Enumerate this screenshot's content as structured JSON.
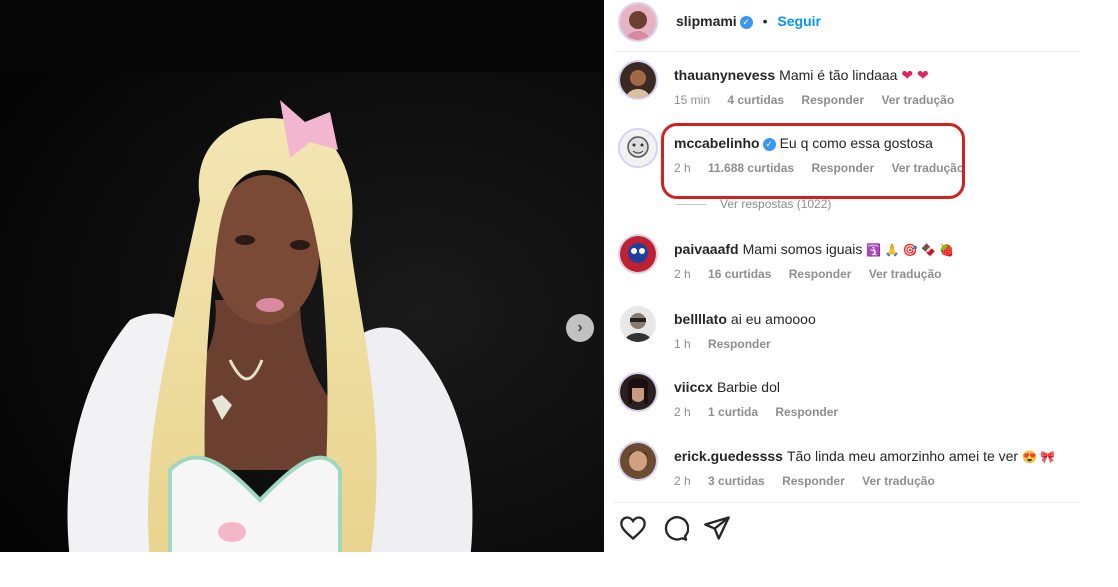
{
  "post": {
    "author": "slipmami",
    "verified_mark": "✓",
    "separator": "•",
    "follow_label": "Seguir"
  },
  "media": {
    "next_icon": "›"
  },
  "comments": [
    {
      "username": "thauanynevess",
      "text": "Mami é tão lindaaa",
      "emoji": "❤ ❤",
      "time": "15 min",
      "likes": "4 curtidas",
      "reply": "Responder",
      "translate": "Ver tradução"
    },
    {
      "username": "mccabelinho",
      "verified": "✓",
      "text": "Eu q como essa gostosa",
      "time": "2 h",
      "likes": "11.688 curtidas",
      "reply": "Responder",
      "translate": "Ver tradução"
    },
    {
      "username": "paivaaafd",
      "text": "Mami somos iguais",
      "emoji": "🛐 🙏 🎯 🍫 🍓",
      "time": "2 h",
      "likes": "16 curtidas",
      "reply": "Responder",
      "translate": "Ver tradução"
    },
    {
      "username": "bellllato",
      "text": "ai eu amoooo",
      "time": "1 h",
      "reply": "Responder"
    },
    {
      "username": "viiccx",
      "text": "Barbie dol",
      "time": "2 h",
      "likes": "1 curtida",
      "reply": "Responder"
    },
    {
      "username": "erick.guedessss",
      "text": "Tão linda meu amorzinho amei te ver",
      "emoji": "😍 🎀",
      "time": "2 h",
      "likes": "3 curtidas",
      "reply": "Responder",
      "translate": "Ver tradução"
    }
  ],
  "view_replies": "Ver respostas (1022)",
  "highlight_color": "#d32020",
  "accent_color": "#0095f6",
  "icons": [
    "heart-icon",
    "comment-icon",
    "share-icon"
  ]
}
